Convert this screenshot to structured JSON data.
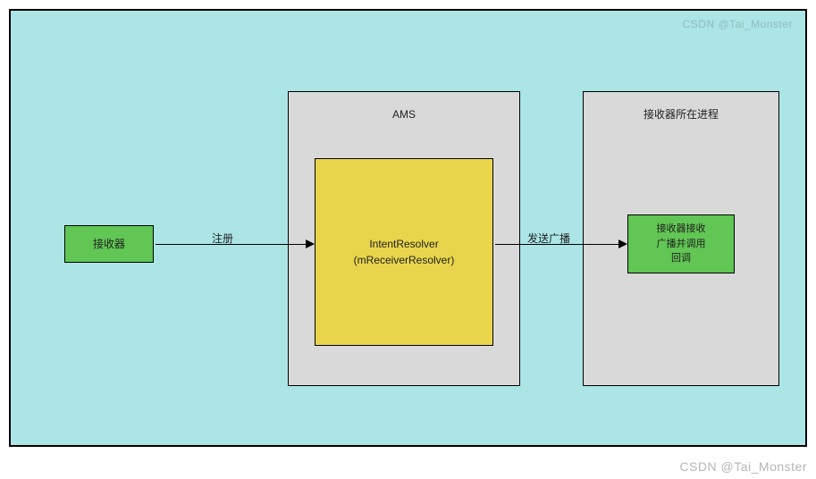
{
  "nodes": {
    "receiver": {
      "label": "接收器"
    },
    "ams": {
      "title": "AMS"
    },
    "resolver": {
      "line1": "IntentResolver",
      "line2": "(mReceiverResolver)"
    },
    "process": {
      "title": "接收器所在进程"
    },
    "callback": {
      "line1": "接收器接收",
      "line2": "广播并调用",
      "line3": "回调"
    }
  },
  "edges": {
    "register": {
      "label": "注册"
    },
    "send": {
      "label": "发送广播"
    }
  },
  "watermark": {
    "top": "CSDN @Tai_Monster",
    "bottom": "CSDN @Tai_Monster"
  }
}
